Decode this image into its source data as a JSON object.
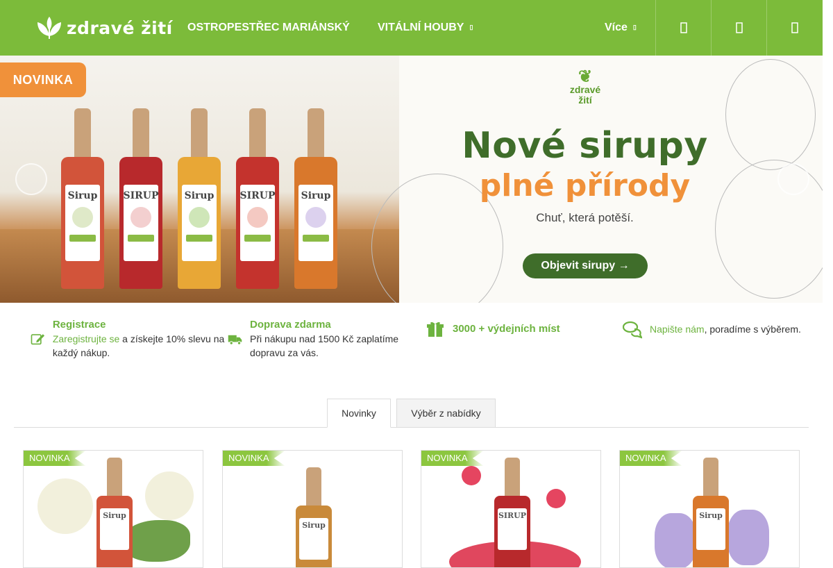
{
  "header": {
    "logo_text": "zdravé žití",
    "nav": [
      {
        "label": "OSTROPESTŘEC MARIÁNSKÝ"
      },
      {
        "label": "VITÁLNÍ HOUBY",
        "caret": "▯"
      },
      {
        "label": "Více",
        "caret": "▯"
      }
    ],
    "icons": [
      "search-icon",
      "user-icon",
      "cart-icon"
    ]
  },
  "banner": {
    "badge": "NOVINKA",
    "logo_line1": "zdravé",
    "logo_line2": "žití",
    "headline": "Nové sirupy",
    "headline2": "plné přírody",
    "subtitle": "Chuť, která potěší.",
    "cta": "Objevit sirupy →",
    "bottles": [
      {
        "label": "Sirup",
        "color": "#d2543a"
      },
      {
        "label": "SIRUP",
        "color": "#b8292c"
      },
      {
        "label": "Sirup",
        "color": "#e8a736"
      },
      {
        "label": "SIRUP",
        "color": "#c4332d"
      },
      {
        "label": "Sirup",
        "color": "#d9782c"
      }
    ],
    "colors": {
      "accent_green": "#3f6d2a",
      "accent_orange": "#f0913a"
    }
  },
  "benefits": [
    {
      "icon": "edit-icon",
      "title": "Registrace",
      "link": "Zaregistrujte se",
      "text": " a získejte 10% slevu na každý nákup."
    },
    {
      "icon": "truck-icon",
      "title": "Doprava zdarma",
      "text": "Při nákupu nad 1500 Kč zaplatíme dopravu za vás."
    },
    {
      "icon": "gift-icon",
      "title": "3000 + výdejních míst"
    },
    {
      "icon": "chat-icon",
      "link": "Napište nám",
      "text": ", poradíme s výběrem."
    }
  ],
  "tabs": [
    {
      "label": "Novinky",
      "active": true
    },
    {
      "label": "Výběr z nabídky",
      "active": false
    }
  ],
  "products": [
    {
      "badge": "NOVINKA",
      "bottle_label": "Sirup",
      "color": "#d2543a"
    },
    {
      "badge": "NOVINKA",
      "bottle_label": "Sirup",
      "color": "#c98a3a"
    },
    {
      "badge": "NOVINKA",
      "bottle_label": "SIRUP",
      "color": "#b8292c"
    },
    {
      "badge": "NOVINKA",
      "bottle_label": "Sirup",
      "color": "#d9782c"
    }
  ],
  "colors": {
    "brand_green": "#7cbb3a",
    "link_green": "#6db33f"
  }
}
